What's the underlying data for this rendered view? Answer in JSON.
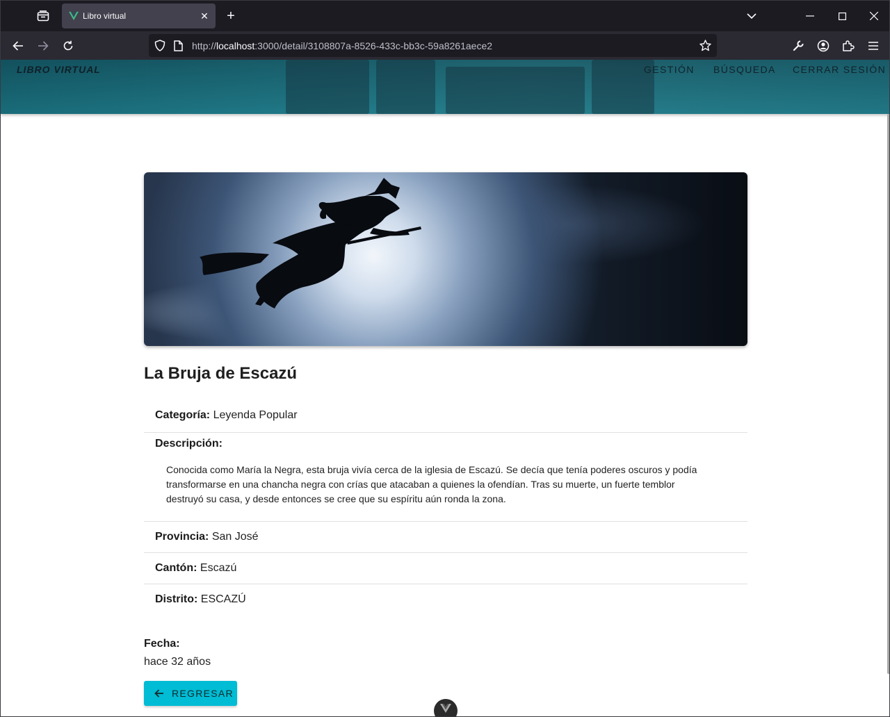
{
  "browser": {
    "tab_title": "Libro virtual",
    "url_prefix": "http://",
    "url_host": "localhost",
    "url_rest": ":3000/detail/3108807a-8526-433c-bb3c-59a8261aece2"
  },
  "header": {
    "brand": "LIBRO VIRTUAL",
    "nav": [
      "GESTIÓN",
      "BÚSQUEDA",
      "CERRAR SESIÓN"
    ]
  },
  "legend": {
    "title": "La Bruja de Escazú",
    "categoria_label": "Categoría:",
    "categoria_value": "Leyenda Popular",
    "descripcion_label": "Descripción:",
    "descripcion_text": "Conocida como María la Negra, esta bruja vivía cerca de la iglesia de Escazú. Se decía que tenía poderes oscuros y podía transformarse en una chancha negra con crías que atacaban a quienes la ofendían. Tras su muerte, un fuerte temblor destruyó su casa, y desde entonces se cree que su espíritu aún ronda la zona.",
    "provincia_label": "Provincia:",
    "provincia_value": "San José",
    "canton_label": "Cantón:",
    "canton_value": "Escazú",
    "distrito_label": "Distrito:",
    "distrito_value": "ESCAZÚ",
    "fecha_label": "Fecha:",
    "fecha_value": "hace 32 años",
    "back_label": "REGRESAR"
  },
  "colors": {
    "accent": "#00bcd4",
    "header_teal": "#2d8593",
    "browser_dark": "#1c1b22"
  }
}
